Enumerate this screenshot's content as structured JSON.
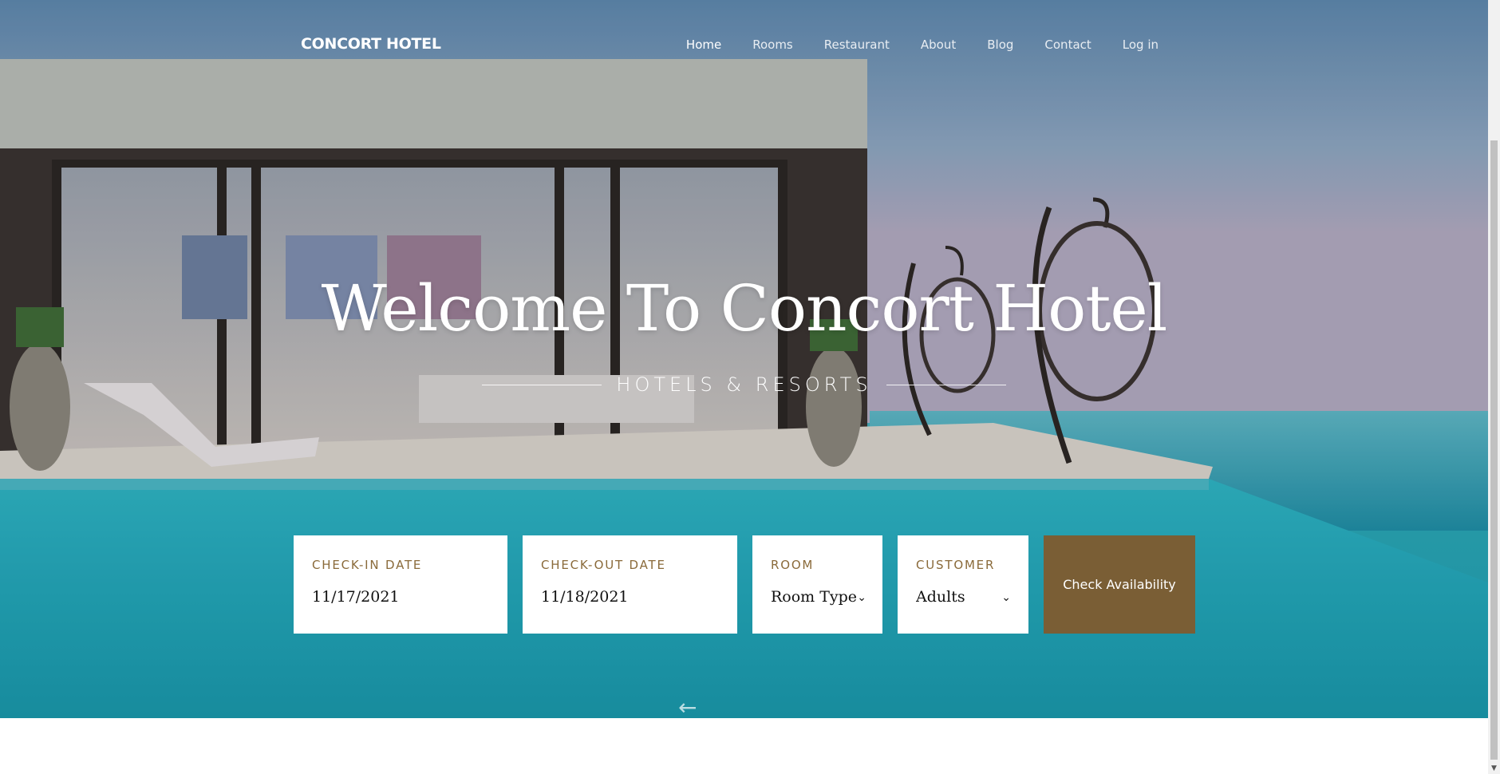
{
  "header": {
    "brand": "CONCORT HOTEL",
    "nav": [
      {
        "label": "Home",
        "active": true
      },
      {
        "label": "Rooms"
      },
      {
        "label": "Restaurant"
      },
      {
        "label": "About"
      },
      {
        "label": "Blog"
      },
      {
        "label": "Contact"
      },
      {
        "label": "Log in"
      }
    ]
  },
  "hero": {
    "title": "Welcome To Concort Hotel",
    "subtitle": "HOTELS & RESORTS"
  },
  "booking": {
    "checkin": {
      "label": "CHECK-IN DATE",
      "value": "11/17/2021"
    },
    "checkout": {
      "label": "CHECK-OUT DATE",
      "value": "11/18/2021"
    },
    "room": {
      "label": "ROOM",
      "value": "Room Type"
    },
    "customer": {
      "label": "CUSTOMER",
      "value": "Adults"
    },
    "submit_label": "Check Availability"
  },
  "slider": {
    "prev_icon": "arrow-left-icon"
  },
  "colors": {
    "accent": "#7a5e35",
    "label": "#8a6a3a"
  }
}
